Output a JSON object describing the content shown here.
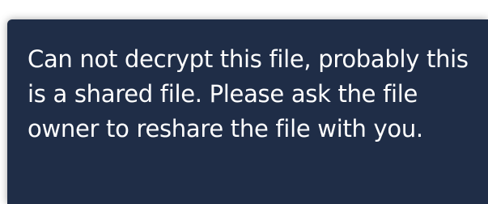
{
  "notification": {
    "message": "Can not decrypt this file, probably this is a shared file. Please ask the file owner to reshare the file with you.",
    "colors": {
      "background": "#1f2d47",
      "text": "#ffffff"
    }
  }
}
